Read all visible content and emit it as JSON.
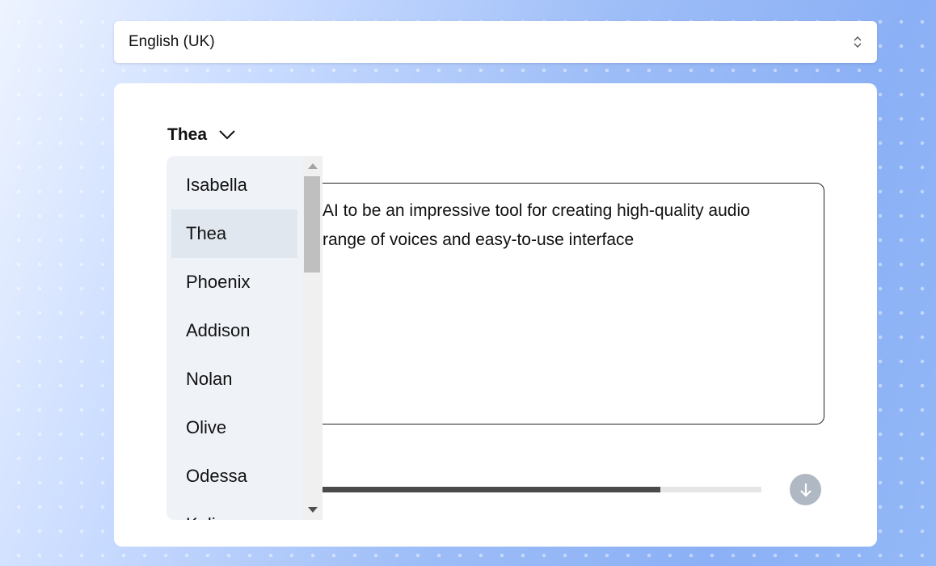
{
  "language_select": {
    "value": "English (UK)",
    "icon": "updown-chevron-icon"
  },
  "voice_selector": {
    "selected": "Thea",
    "icon": "chevron-down-icon"
  },
  "voice_dropdown": {
    "items": [
      "Isabella",
      "Thea",
      "Phoenix",
      "Addison",
      "Nolan",
      "Olive",
      "Odessa",
      "Kali"
    ],
    "selected_index": 1
  },
  "text_input": {
    "lines": [
      "AI to be an impressive tool for creating high-quality audio",
      "range of voices and easy-to-use interface"
    ]
  },
  "audio_progress": {
    "percent": 83
  },
  "download_button": {
    "icon": "download-arrow-icon"
  }
}
